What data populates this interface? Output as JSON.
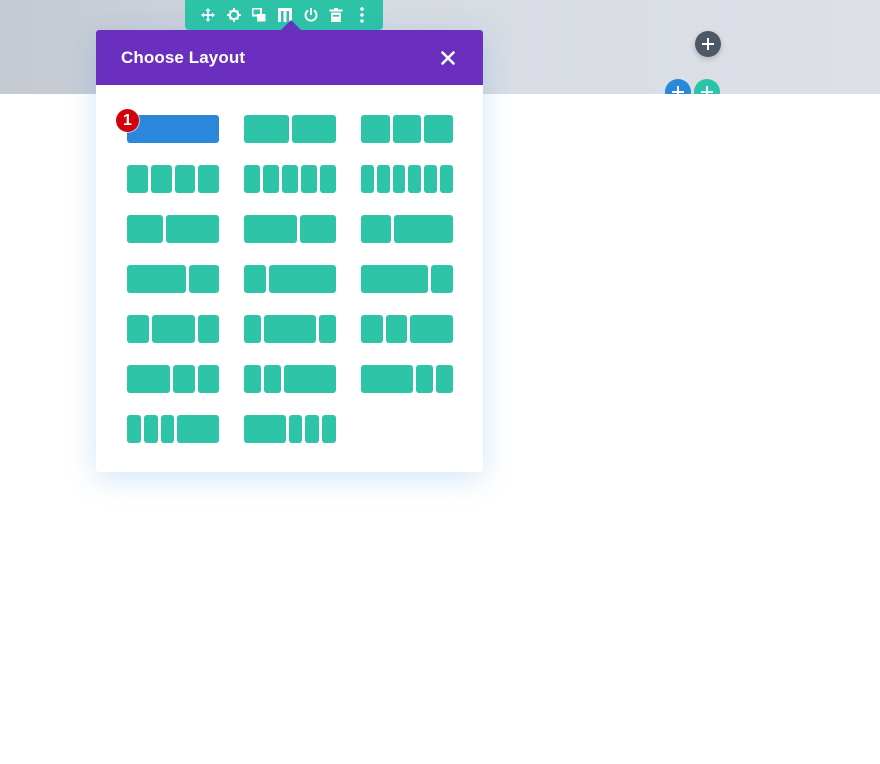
{
  "modal": {
    "title": "Choose Layout",
    "close_icon": "close-icon"
  },
  "toolbar": {
    "icons": [
      "move-icon",
      "gear-icon",
      "duplicate-icon",
      "columns-icon",
      "power-icon",
      "trash-icon",
      "more-icon"
    ]
  },
  "badge": {
    "label": "1",
    "color": "#d3000e"
  },
  "colors": {
    "header": "#6b2fbf",
    "column": "#2ec4a7",
    "selected_column": "#2b87da",
    "add_row_dark": "#4c5866"
  },
  "layouts": [
    {
      "id": "1",
      "cols": [
        1
      ],
      "selected": true
    },
    {
      "id": "1_2,1_2",
      "cols": [
        1,
        1
      ]
    },
    {
      "id": "1_3,1_3,1_3",
      "cols": [
        1,
        1,
        1
      ]
    },
    {
      "id": "1_4x4",
      "cols": [
        1,
        1,
        1,
        1
      ]
    },
    {
      "id": "1_5x5",
      "cols": [
        1,
        1,
        1,
        1,
        1
      ]
    },
    {
      "id": "1_6x6",
      "cols": [
        1,
        1,
        1,
        1,
        1,
        1
      ]
    },
    {
      "id": "2_5,3_5",
      "cols": [
        2,
        3
      ]
    },
    {
      "id": "3_5,2_5",
      "cols": [
        3,
        2
      ]
    },
    {
      "id": "1_3,2_3",
      "cols": [
        1,
        2
      ]
    },
    {
      "id": "2_3,1_3",
      "cols": [
        2,
        1
      ]
    },
    {
      "id": "1_4,3_4",
      "cols": [
        1,
        3
      ]
    },
    {
      "id": "3_4,1_4",
      "cols": [
        3,
        1
      ]
    },
    {
      "id": "1_4,1_2,1_4",
      "cols": [
        1,
        2,
        1
      ]
    },
    {
      "id": "1_5,3_5,1_5",
      "cols": [
        1,
        3,
        1
      ]
    },
    {
      "id": "1_4,1_4,1_2",
      "cols": [
        1,
        1,
        2
      ]
    },
    {
      "id": "1_2,1_4,1_4",
      "cols": [
        2,
        1,
        1
      ]
    },
    {
      "id": "1_5,1_5,3_5",
      "cols": [
        1,
        1,
        3
      ]
    },
    {
      "id": "3_5,1_5,1_5",
      "cols": [
        3,
        1,
        1
      ]
    },
    {
      "id": "1_6,1_6,1_6,1_2",
      "cols": [
        1,
        1,
        1,
        3
      ]
    },
    {
      "id": "1_2,1_6,1_6,1_6",
      "cols": [
        3,
        1,
        1,
        1
      ]
    }
  ]
}
